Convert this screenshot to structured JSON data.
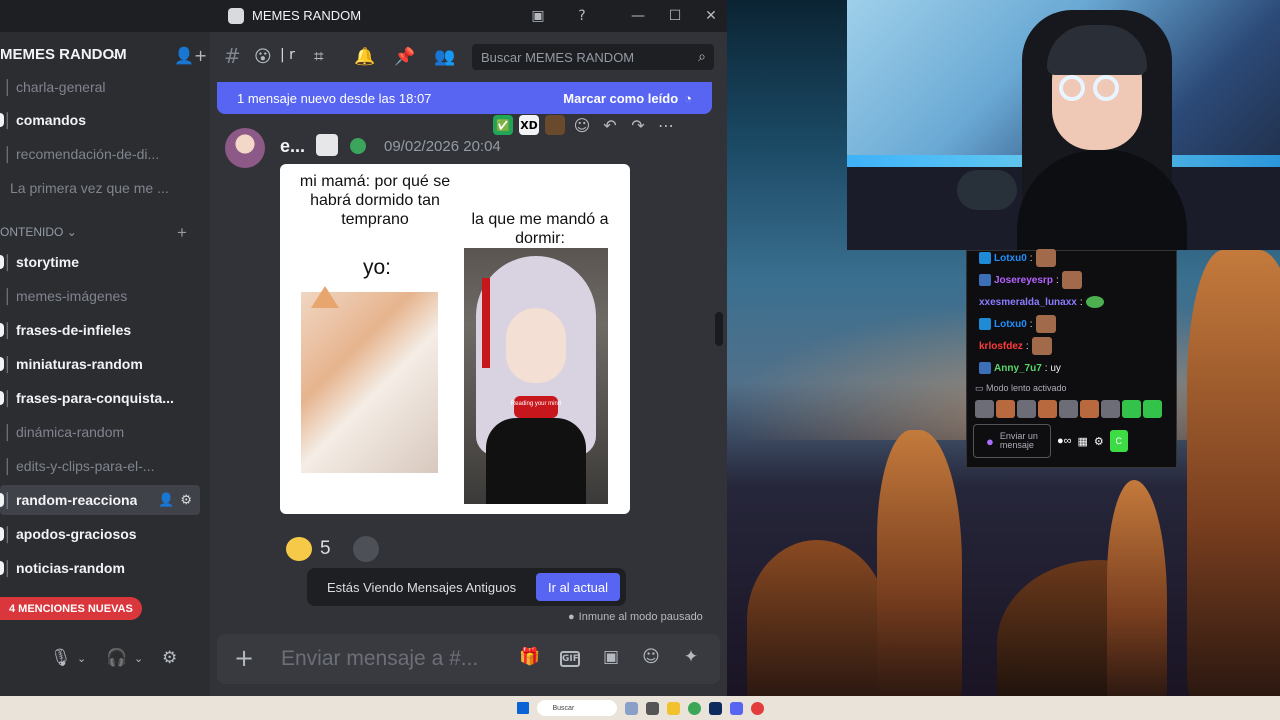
{
  "window": {
    "title": "MEMES RANDOM",
    "buttons": [
      "minimize",
      "maximize",
      "close"
    ]
  },
  "server": {
    "name": "MEMES RANDOM"
  },
  "sidebar": {
    "channels_top": [
      {
        "name": "charla-general",
        "unread": false
      },
      {
        "name": "comandos",
        "unread": true
      },
      {
        "name": "recomendación-de-di...",
        "unread": false
      },
      {
        "name": "La primera vez que me ...",
        "unread": false
      }
    ],
    "category": "ONTENIDO",
    "channels": [
      {
        "name": "storytime",
        "unread": true
      },
      {
        "name": "memes-imágenes",
        "unread": false
      },
      {
        "name": "frases-de-infieles",
        "unread": true
      },
      {
        "name": "miniaturas-random",
        "unread": true
      },
      {
        "name": "frases-para-conquista...",
        "unread": true
      },
      {
        "name": "dinámica-random",
        "unread": false
      },
      {
        "name": "edits-y-clips-para-el-...",
        "unread": false
      },
      {
        "name": "random-reacciona",
        "unread": true,
        "selected": true
      },
      {
        "name": "apodos-graciosos",
        "unread": true
      },
      {
        "name": "noticias-random",
        "unread": true
      }
    ],
    "mentions_pill": "4 MENCIONES NUEVAS"
  },
  "topbar": {
    "channel_fragment": "r",
    "search_placeholder": "Buscar MEMES RANDOM"
  },
  "new_messages_bar": {
    "text": "1 mensaje nuevo desde las 18:07",
    "action": "Marcar como leído"
  },
  "message": {
    "author": "e...",
    "timestamp": "09/02/2026 20:04",
    "quick_reactions": [
      "✅",
      "XD"
    ],
    "meme": {
      "top_text": "mi mamá: por qué se habrá dormido tan temprano",
      "right_text": "la que me mandó a dormir:",
      "yo": "yo:",
      "caption": "Reading your mind"
    },
    "reaction_count": "5"
  },
  "old_messages": {
    "text": "Estás Viendo Mensajes Antiguos",
    "button": "Ir al actual"
  },
  "immune_text": "Inmune al modo pausado",
  "composer": {
    "placeholder": "Enviar mensaje a #..."
  },
  "chat_overlay": {
    "lines": [
      {
        "user": "Lotxu0",
        "text": ":",
        "color": "#1e90ff"
      },
      {
        "user": "Josereyesrp",
        "text": ":",
        "color": "#b463ff"
      },
      {
        "user": "xxesmeralda_lunaxx",
        "text": ":",
        "color": "#8a7cff"
      },
      {
        "user": "Lotxu0",
        "text": ":",
        "color": "#1e90ff"
      },
      {
        "user": "krlosfdez",
        "text": ":",
        "color": "#ff3b3b"
      },
      {
        "user": "Anny_7u7",
        "text": ": uy",
        "color": "#5bd66a"
      }
    ],
    "slow_mode": "Modo lento activado",
    "input_placeholder": "Enviar un mensaje",
    "chat_button": "C"
  },
  "taskbar": {
    "search": "Buscar"
  }
}
